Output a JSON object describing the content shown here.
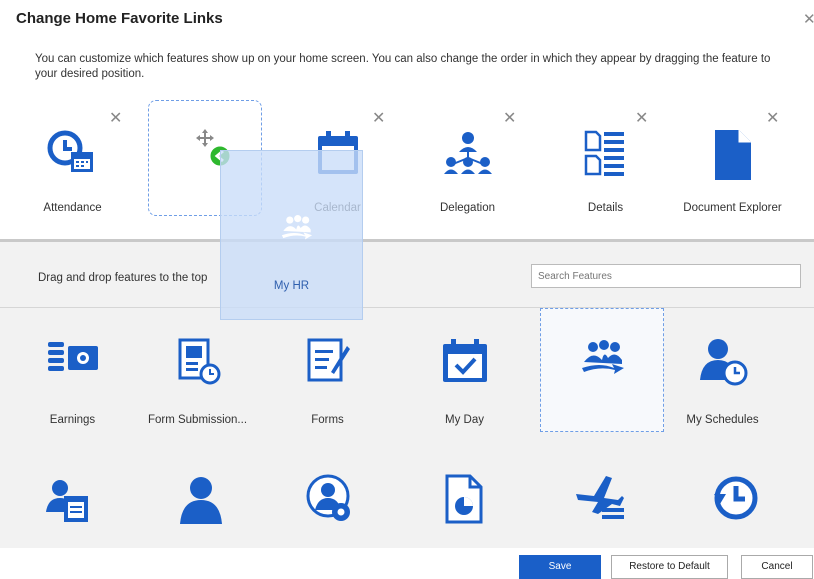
{
  "dialog": {
    "title": "Change Home Favorite Links",
    "close_glyph": "✕",
    "intro": "You can customize which features show up on your home screen. You can also change the order in which they appear by dragging the feature to your desired position."
  },
  "favorites": [
    {
      "label": "Attendance",
      "icon": "attendance-icon"
    },
    {
      "label": "Calendar",
      "icon": "calendar-icon"
    },
    {
      "label": "Delegation",
      "icon": "delegation-icon"
    },
    {
      "label": "Details",
      "icon": "details-icon"
    },
    {
      "label": "Document Explorer",
      "icon": "document-icon"
    }
  ],
  "remove_glyph": "✕",
  "dragging": {
    "label": "My HR",
    "icon": "my-hr-icon"
  },
  "lower": {
    "hint": "Drag and drop features to the top",
    "search_placeholder": "Search Features"
  },
  "features": [
    {
      "label": "Earnings",
      "icon": "earnings-icon"
    },
    {
      "label": "Form Submission...",
      "icon": "form-submission-icon"
    },
    {
      "label": "Forms",
      "icon": "forms-icon"
    },
    {
      "label": "My Day",
      "icon": "my-day-icon"
    },
    {
      "label": "",
      "icon": "my-hr-icon"
    },
    {
      "label": "My Schedules",
      "icon": "my-schedules-icon"
    }
  ],
  "buttons": {
    "save": "Save",
    "restore": "Restore to Default",
    "cancel": "Cancel"
  },
  "colors": {
    "brand_blue": "#1b5fc7",
    "drop_border": "#6f9ee6",
    "green": "#2eb82e"
  }
}
